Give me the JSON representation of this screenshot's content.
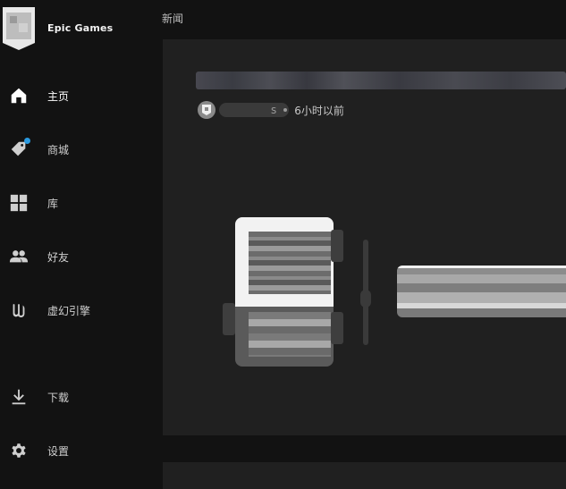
{
  "brand": {
    "name": "Epic Games"
  },
  "sidebar": {
    "items": [
      {
        "label": "主页",
        "icon": "home-icon",
        "active": true
      },
      {
        "label": "商城",
        "icon": "tag-icon",
        "badge": true
      },
      {
        "label": "库",
        "icon": "grid-icon"
      },
      {
        "label": "好友",
        "icon": "friends-icon"
      },
      {
        "label": "虚幻引擎",
        "icon": "unreal-icon"
      },
      {
        "label": "下载",
        "icon": "download-icon"
      },
      {
        "label": "设置",
        "icon": "gear-icon"
      }
    ]
  },
  "main": {
    "title": "新闻",
    "news": {
      "author": "s",
      "time": "6小时以前"
    }
  },
  "colors": {
    "background": "#121212",
    "card": "#202020",
    "badge": "#2a9ae0"
  }
}
